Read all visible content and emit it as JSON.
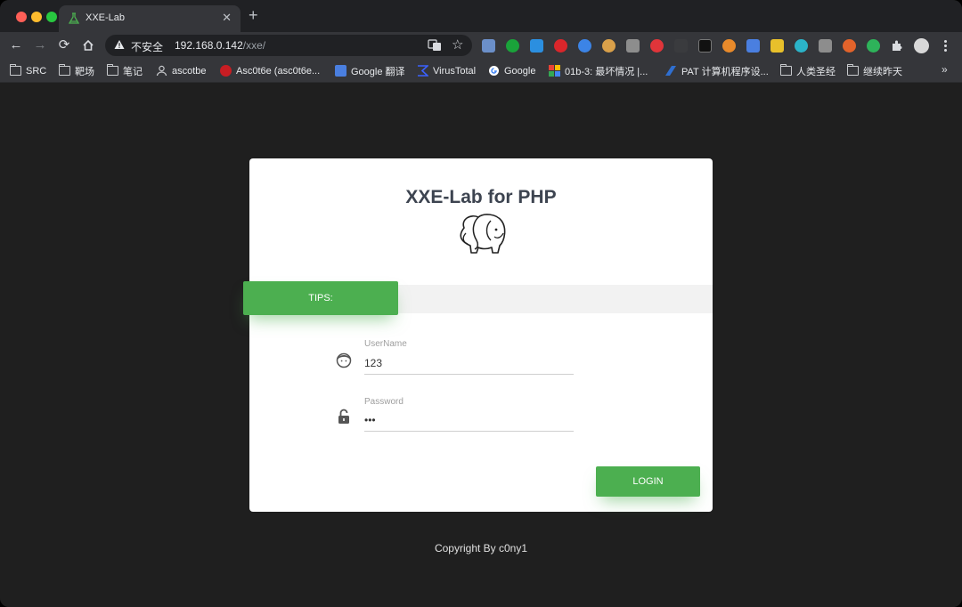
{
  "browser": {
    "tab": {
      "title": "XXE-Lab",
      "close_glyph": "✕",
      "favicon": "flask-icon"
    },
    "new_tab_glyph": "+",
    "omnibox": {
      "security_label": "不安全",
      "url_host": "192.168.0.142",
      "url_path": "/xxe/"
    },
    "bookmarks": [
      {
        "label": "SRC",
        "icon": "folder-icon"
      },
      {
        "label": "靶场",
        "icon": "folder-icon"
      },
      {
        "label": "笔记",
        "icon": "folder-icon"
      },
      {
        "label": "ascotbe",
        "icon": "user-icon"
      },
      {
        "label": "Asc0t6e (asc0t6e...",
        "icon": "gitee-icon"
      },
      {
        "label": "Google 翻译",
        "icon": "google-translate-icon"
      },
      {
        "label": "VirusTotal",
        "icon": "virustotal-icon"
      },
      {
        "label": "Google",
        "icon": "google-icon"
      },
      {
        "label": "01b-3: 最坏情况 |...",
        "icon": "colorful-grid-icon"
      },
      {
        "label": "PAT 计算机程序设...",
        "icon": "pat-icon"
      },
      {
        "label": "人类圣经",
        "icon": "folder-icon"
      },
      {
        "label": "继续昨天",
        "icon": "folder-icon"
      }
    ],
    "bookmarks_more": "»"
  },
  "page": {
    "title": "XXE-Lab for PHP",
    "tips_label": "TIPS:",
    "username": {
      "label": "UserName",
      "value": "123"
    },
    "password": {
      "label": "Password",
      "value": "•••"
    },
    "login_label": "LOGIN",
    "copyright": "Copyright By c0ny1"
  },
  "colors": {
    "accent_green": "#4caf50",
    "page_background": "#1f1f1f",
    "title_color": "#3d4450"
  }
}
